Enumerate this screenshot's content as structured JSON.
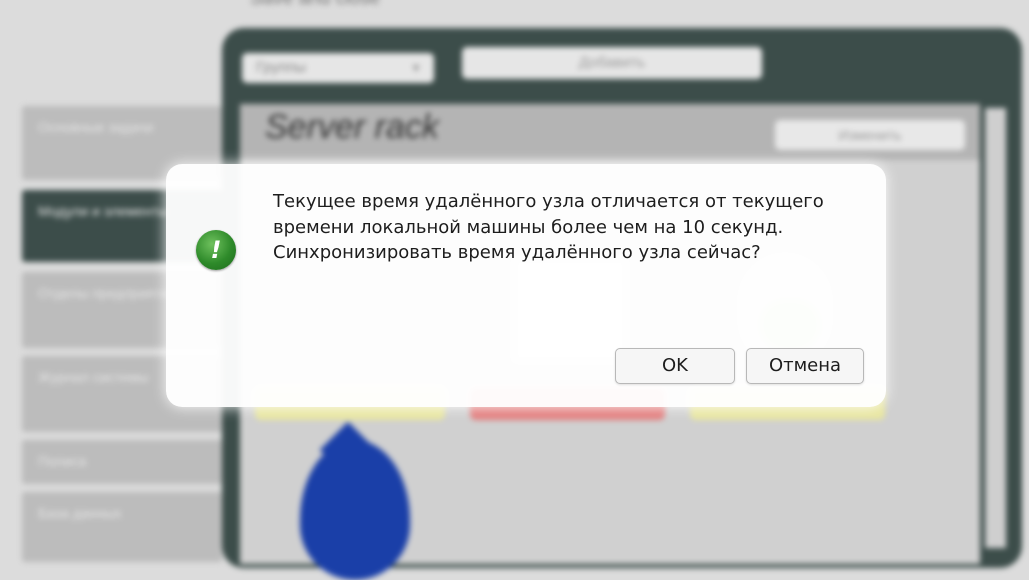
{
  "app": {
    "top_caption": "Save and close",
    "groups_select": "Группы",
    "add_button": "Добавить",
    "content_title": "Server rack",
    "change_button": "Изменить",
    "sidebar": [
      {
        "label": "Основные задачи"
      },
      {
        "label": "Модули и элементы"
      },
      {
        "label": "Отделы предприятия"
      },
      {
        "label": "Журнал системы"
      },
      {
        "label": "Полиса"
      },
      {
        "label": "База данных"
      }
    ],
    "badge_colors": [
      "#e8e6a0",
      "#e27c7c",
      "#e8e6a0"
    ]
  },
  "dialog": {
    "icon": "exclamation-icon",
    "icon_glyph": "!",
    "message": "Текущее время удалённого узла отличается от текущего времени локальной машины более чем на 10 секунд. Синхронизировать время удалённого узла сейчас?",
    "ok_label": "OK",
    "cancel_label": "Отмена",
    "icon_color": "#2e8a2a"
  }
}
